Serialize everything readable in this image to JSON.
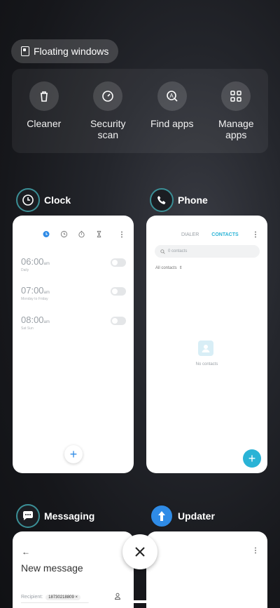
{
  "floating_windows": {
    "label": "Floating windows"
  },
  "tools": [
    {
      "label": "Cleaner",
      "icon": "trash-icon"
    },
    {
      "label": "Security\nscan",
      "icon": "gauge-icon"
    },
    {
      "label": "Find apps",
      "icon": "search-a-icon"
    },
    {
      "label": "Manage\napps",
      "icon": "grid-icon"
    }
  ],
  "apps": {
    "clock": {
      "name": "Clock",
      "alarms": [
        {
          "time": "06:00",
          "ampm": "am",
          "days": "Daily"
        },
        {
          "time": "07:00",
          "ampm": "am",
          "days": "Monday to Friday"
        },
        {
          "time": "08:00",
          "ampm": "am",
          "days": "Sat Sun"
        }
      ],
      "add": "+"
    },
    "phone": {
      "name": "Phone",
      "tab_dialer": "DIALER",
      "tab_contacts": "CONTACTS",
      "search_placeholder": "0 contacts",
      "filter": "All contacts",
      "empty": "No contacts",
      "add": "+"
    },
    "messaging": {
      "name": "Messaging",
      "title": "New message",
      "recipient_label": "Recipient:",
      "recipient_chip": "18730218809"
    },
    "updater": {
      "name": "Updater"
    }
  },
  "colors": {
    "accent": "#2ab3d6",
    "clock_icon_blue": "#2f8be6"
  }
}
